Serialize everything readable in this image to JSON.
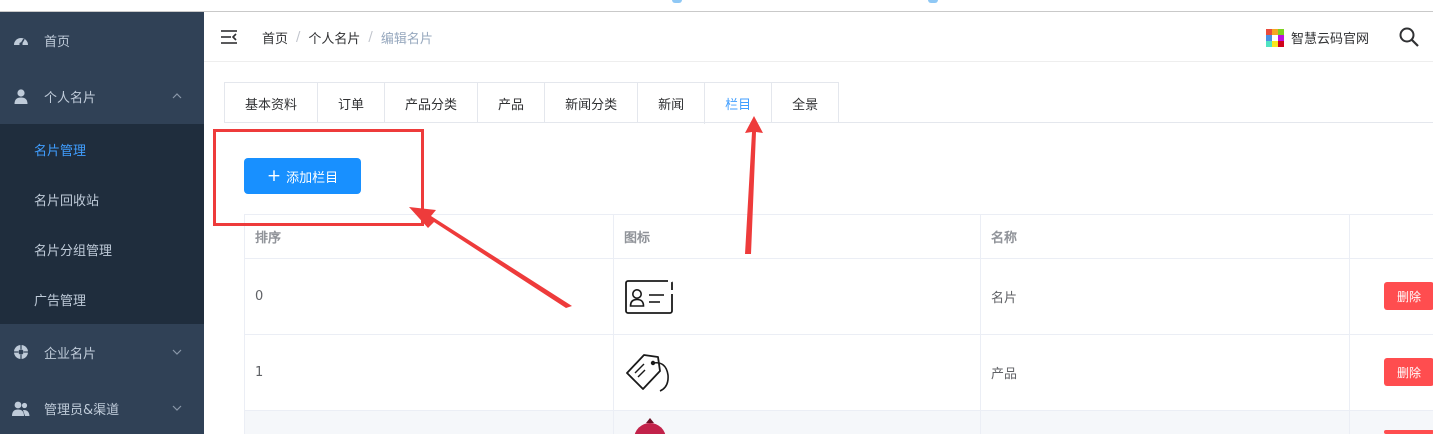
{
  "sidebar": {
    "items": [
      {
        "label": "首页",
        "icon": "dashboard-icon"
      },
      {
        "label": "个人名片",
        "icon": "user-icon",
        "expanded": true
      },
      {
        "label": "企业名片",
        "icon": "aperture-icon"
      },
      {
        "label": "管理员&渠道",
        "icon": "users-icon"
      }
    ],
    "submenu": [
      {
        "label": "名片管理",
        "active": true
      },
      {
        "label": "名片回收站"
      },
      {
        "label": "名片分组管理"
      },
      {
        "label": "广告管理"
      }
    ]
  },
  "navbar": {
    "breadcrumb": [
      "首页",
      "个人名片",
      "编辑名片"
    ],
    "separator": "/",
    "brand": "智慧云码官网"
  },
  "tabs": [
    "基本资料",
    "订单",
    "产品分类",
    "产品",
    "新闻分类",
    "新闻",
    "栏目",
    "全景"
  ],
  "active_tab": "栏目",
  "add_button": {
    "label": "添加栏目",
    "icon": "plus-icon"
  },
  "table": {
    "headers": [
      "排序",
      "图标",
      "名称",
      ""
    ],
    "rows": [
      {
        "order": "0",
        "icon": "business-card-icon",
        "name": "名片",
        "action": "删除"
      },
      {
        "order": "1",
        "icon": "price-tag-icon",
        "name": "产品",
        "action": "删除"
      },
      {
        "order": "",
        "icon": "pomegranate-icon",
        "name": "",
        "action": ""
      }
    ]
  },
  "colors": {
    "sidebar_bg": "#304156",
    "submenu_bg": "#1f2d3d",
    "active_text": "#409eff",
    "primary_button": "#1890ff",
    "delete_button": "#ff4d4f",
    "annotation_red": "#ee3b3b"
  }
}
